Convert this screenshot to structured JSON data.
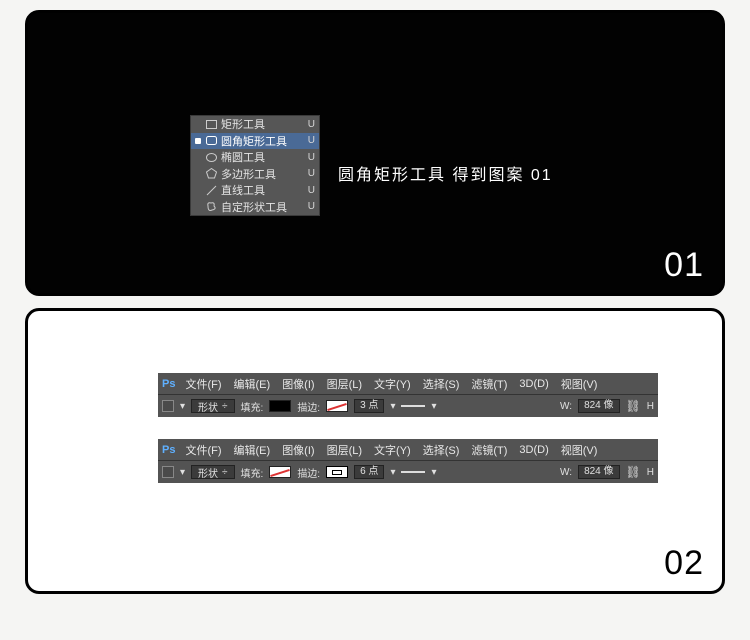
{
  "step1": {
    "number": "01",
    "menu": [
      {
        "sel": false,
        "label": "矩形工具",
        "key": "U",
        "icon": "rect"
      },
      {
        "sel": true,
        "label": "圆角矩形工具",
        "key": "U",
        "icon": "roundrect"
      },
      {
        "sel": false,
        "label": "椭圆工具",
        "key": "U",
        "icon": "ellipse"
      },
      {
        "sel": false,
        "label": "多边形工具",
        "key": "U",
        "icon": "polygon"
      },
      {
        "sel": false,
        "label": "直线工具",
        "key": "U",
        "icon": "line"
      },
      {
        "sel": false,
        "label": "自定形状工具",
        "key": "U",
        "icon": "custom"
      }
    ],
    "caption": "圆角矩形工具  得到图案  01"
  },
  "ps_menu": [
    "文件(F)",
    "编辑(E)",
    "图像(I)",
    "图层(L)",
    "文字(Y)",
    "选择(S)",
    "滤镜(T)",
    "3D(D)",
    "视图(V)"
  ],
  "ps_logo": "Ps",
  "step2": {
    "number": "02",
    "opt1": {
      "mode": "形状",
      "fill_label": "填充:",
      "fill_swatch": "black",
      "stroke_label": "描边:",
      "stroke_swatch": "redstrike",
      "stroke_val": "3 点",
      "w_label": "W:",
      "w_val": "824 像",
      "trail": "H"
    },
    "opt2": {
      "mode": "形状",
      "fill_label": "填充:",
      "fill_swatch": "redstrike",
      "stroke_label": "描边:",
      "stroke_swatch": "whitebox",
      "stroke_val": "6 点",
      "w_label": "W:",
      "w_val": "824 像",
      "trail": "H"
    }
  }
}
